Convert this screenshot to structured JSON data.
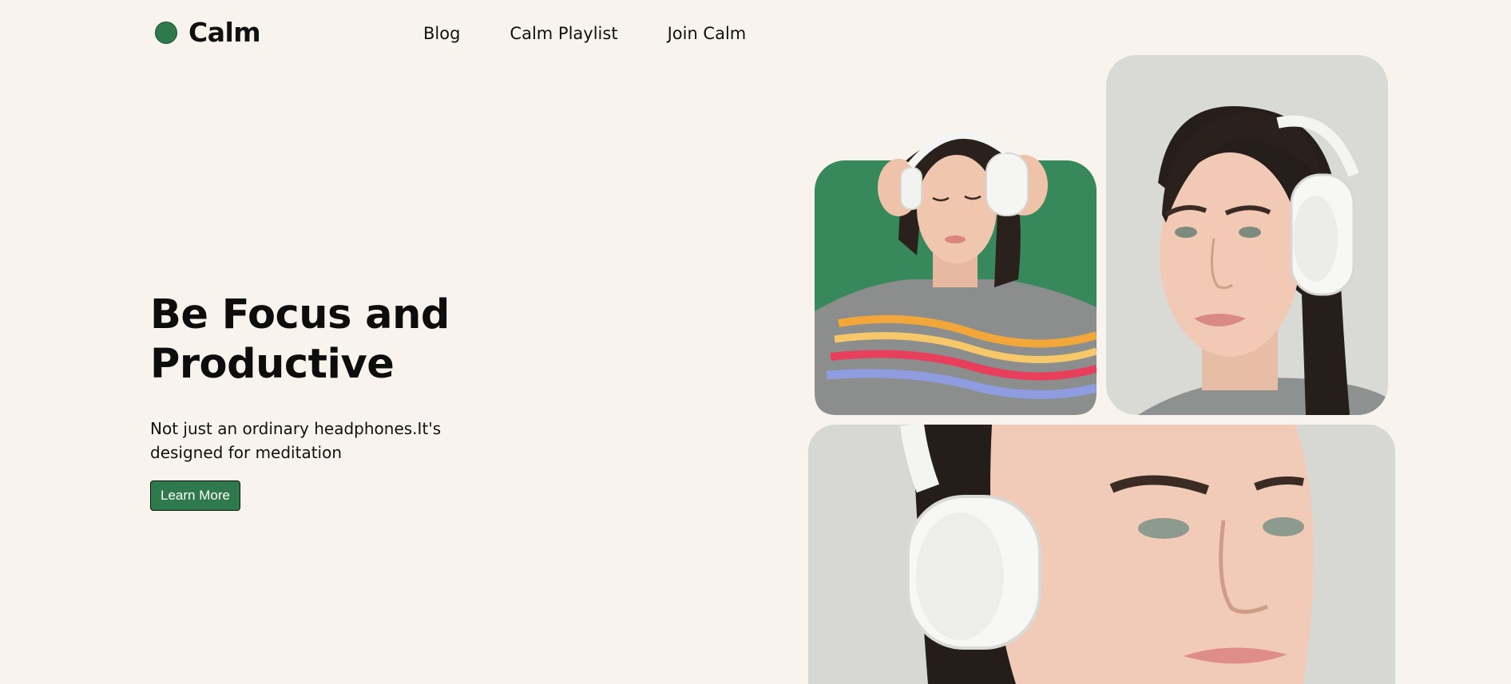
{
  "brand": {
    "name": "Calm",
    "accent_color": "#2f7a4d",
    "background_color": "#f8f4ed"
  },
  "nav": {
    "links": [
      {
        "label": "Blog"
      },
      {
        "label": "Calm Playlist"
      },
      {
        "label": "Join Calm"
      }
    ]
  },
  "hero": {
    "title_line1": "Be Focus and",
    "title_line2": "Productive",
    "subtitle_line1": "Not just an ordinary headphones.It's",
    "subtitle_line2": "designed for meditation",
    "cta_label": "Learn More"
  },
  "gallery": {
    "images": [
      {
        "subject": "woman-headphones-green-card-photo"
      },
      {
        "subject": "woman-headphones-portrait-photo"
      },
      {
        "subject": "woman-headphones-closeup-photo"
      }
    ]
  }
}
